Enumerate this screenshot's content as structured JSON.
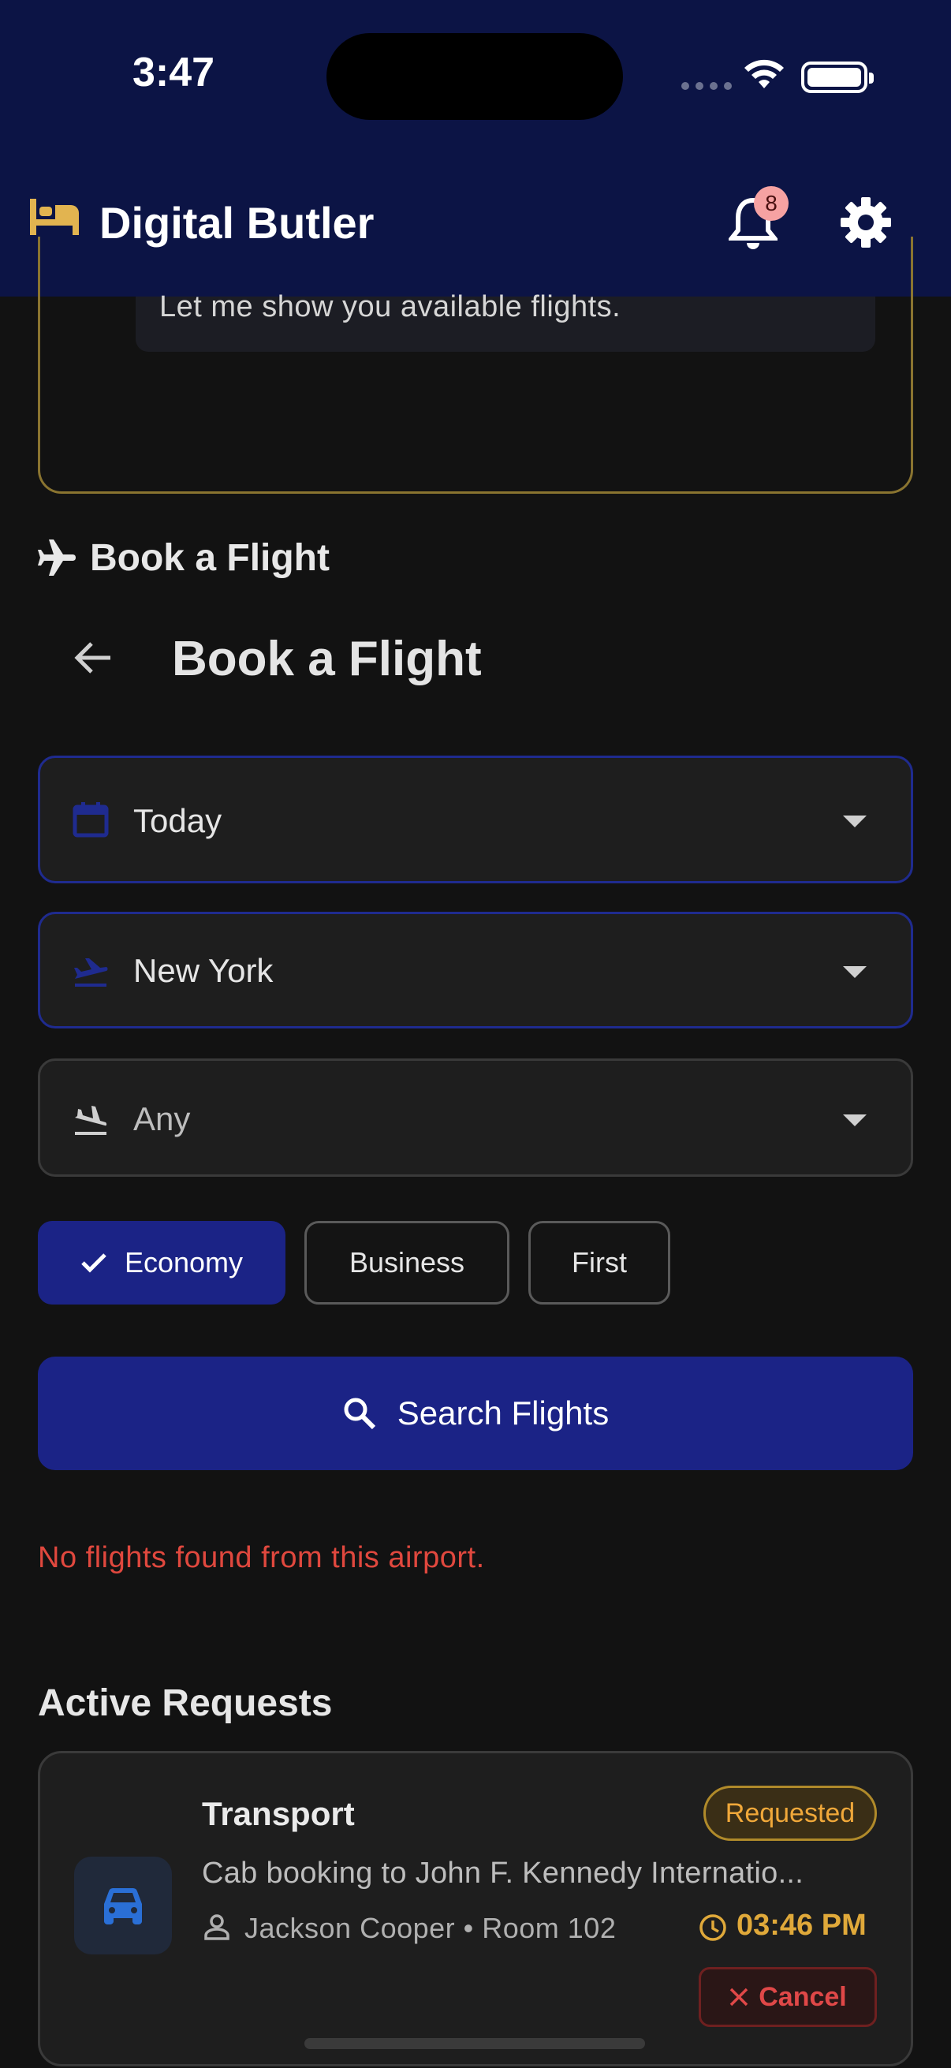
{
  "status_bar": {
    "time": "3:47"
  },
  "header": {
    "app_icon": "bed-icon",
    "title": "Digital Butler",
    "notifications_count": "8",
    "bell_icon": "bell-icon",
    "settings_icon": "gear-icon",
    "background": "#0c1445"
  },
  "chat": {
    "message": "Let me show you available flights."
  },
  "section": {
    "icon": "airplane-icon",
    "title": "Book a Flight"
  },
  "page": {
    "back_icon": "arrow-left-icon",
    "title": "Book a Flight"
  },
  "form": {
    "date": {
      "icon": "calendar-icon",
      "value": "Today"
    },
    "departure": {
      "icon": "flight-takeoff-icon",
      "value": "New York"
    },
    "arrival": {
      "icon": "flight-land-icon",
      "value": "Any"
    },
    "classes": [
      {
        "label": "Economy",
        "selected": true
      },
      {
        "label": "Business",
        "selected": false
      },
      {
        "label": "First",
        "selected": false
      }
    ],
    "search_label": "Search Flights",
    "accent": "#1b2386"
  },
  "error": "No flights found from this airport.",
  "active_requests": {
    "title": "Active Requests",
    "items": [
      {
        "icon": "car-icon",
        "title": "Transport",
        "status": "Requested",
        "description": "Cab booking to John F. Kennedy Internatio...",
        "guest": "Jackson Cooper • Room 102",
        "time": "03:46 PM",
        "cancel_label": "Cancel"
      }
    ]
  }
}
